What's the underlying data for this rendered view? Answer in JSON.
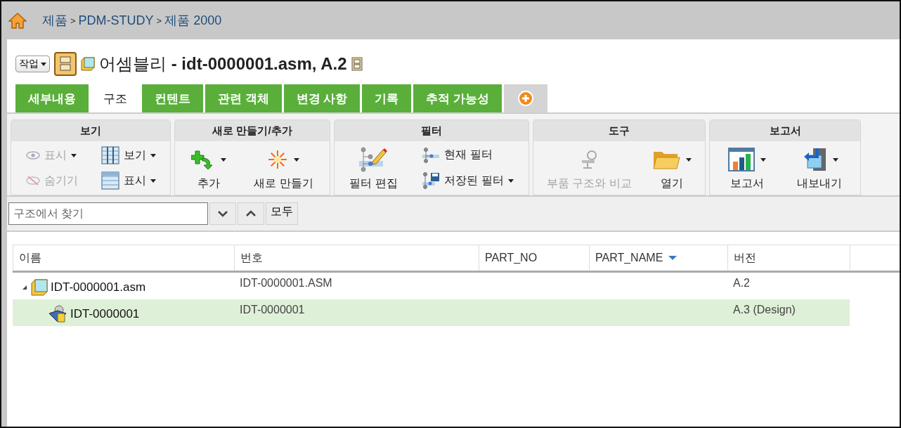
{
  "breadcrumb": {
    "items": [
      "제품",
      "PDM-STUDY",
      "제품 2000"
    ],
    "separator": ">"
  },
  "header": {
    "action_menu": "작업",
    "type_label": "어셈블리",
    "name": "- idt-0000001.asm, A.2"
  },
  "tabs": [
    {
      "label": "세부내용",
      "selected": false
    },
    {
      "label": "구조",
      "selected": true
    },
    {
      "label": "컨텐트",
      "selected": false
    },
    {
      "label": "관련 객체",
      "selected": false
    },
    {
      "label": "변경 사항",
      "selected": false
    },
    {
      "label": "기록",
      "selected": false
    },
    {
      "label": "추적 가능성",
      "selected": false
    }
  ],
  "ribbon": [
    {
      "title": "보기",
      "columns": [
        [
          {
            "kind": "small",
            "label": "표시",
            "disabled": true,
            "dropdown": true
          },
          {
            "kind": "small",
            "label": "숨기기",
            "disabled": true,
            "dropdown": false
          }
        ],
        [
          {
            "kind": "small",
            "label": "보기",
            "disabled": false,
            "dropdown": true
          },
          {
            "kind": "small",
            "label": "표시",
            "disabled": false,
            "dropdown": true
          }
        ]
      ]
    },
    {
      "title": "새로 만들기/추가",
      "columns": [
        [
          {
            "kind": "large",
            "label": "추가",
            "disabled": false,
            "dropdown": true
          }
        ],
        [
          {
            "kind": "large",
            "label": "새로 만들기",
            "disabled": false,
            "dropdown": true
          }
        ]
      ]
    },
    {
      "title": "필터",
      "columns": [
        [
          {
            "kind": "large",
            "label": "필터 편집",
            "disabled": false,
            "dropdown": false
          }
        ],
        [
          {
            "kind": "small",
            "label": "현재 필터",
            "disabled": false,
            "dropdown": false
          },
          {
            "kind": "small",
            "label": "저장된 필터",
            "disabled": false,
            "dropdown": true
          }
        ]
      ]
    },
    {
      "title": "도구",
      "columns": [
        [
          {
            "kind": "large",
            "label": "부품 구조와 비교",
            "disabled": true,
            "dropdown": false
          }
        ],
        [
          {
            "kind": "large",
            "label": "열기",
            "disabled": false,
            "dropdown": true
          }
        ]
      ]
    },
    {
      "title": "보고서",
      "columns": [
        [
          {
            "kind": "large",
            "label": "보고서",
            "disabled": false,
            "dropdown": true
          }
        ],
        [
          {
            "kind": "large",
            "label": "내보내기",
            "disabled": false,
            "dropdown": true
          }
        ]
      ]
    }
  ],
  "find": {
    "placeholder": "구조에서 찾기",
    "all_button": "모두"
  },
  "table": {
    "columns": [
      {
        "label": "이름",
        "sorted": false
      },
      {
        "label": "번호",
        "sorted": false
      },
      {
        "label": "PART_NO",
        "sorted": false
      },
      {
        "label": "PART_NAME",
        "sorted": true
      },
      {
        "label": "버전",
        "sorted": false
      }
    ],
    "rows": [
      {
        "name": "IDT-0000001.asm",
        "number": "IDT-0000001.ASM",
        "version": "A.2",
        "selected": false,
        "expanded": true,
        "children": [
          {
            "name": "IDT-0000001",
            "number": "IDT-0000001",
            "version": "A.3 (Design)",
            "selected": true
          }
        ]
      }
    ]
  }
}
